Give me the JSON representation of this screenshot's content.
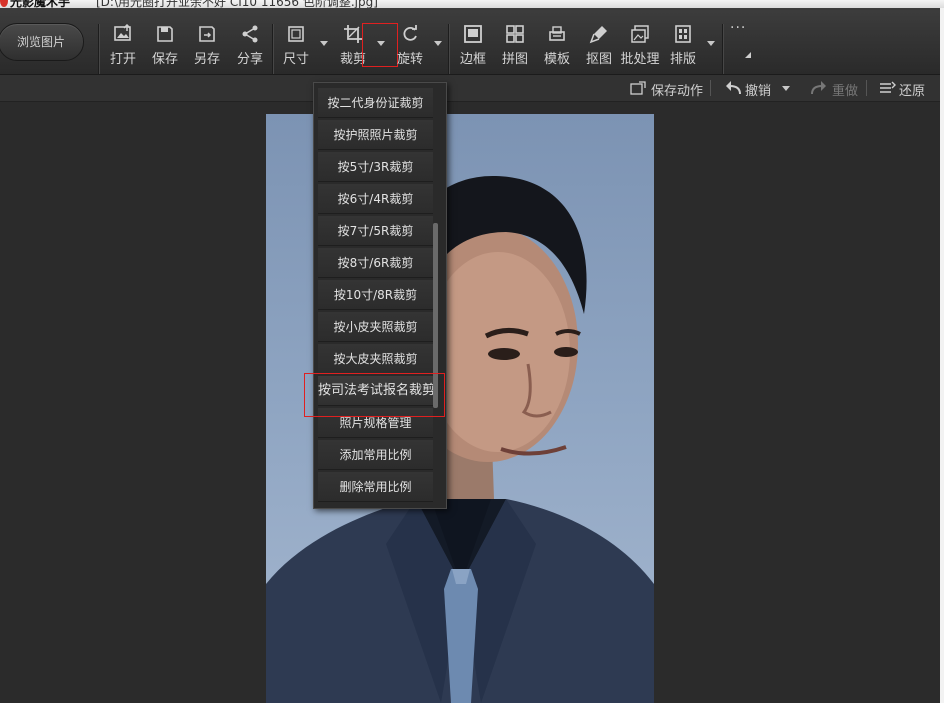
{
  "titlebar": {
    "app_name": "光影魔术手",
    "doc_title": "[D:\\用光圈打开业余不好 CI10 11656 色阶调整.jpg]"
  },
  "toolbar": {
    "browse_label": "浏览图片",
    "tools": [
      {
        "id": "open",
        "label": "打开",
        "icon": "image-open-icon"
      },
      {
        "id": "save",
        "label": "保存",
        "icon": "save-icon"
      },
      {
        "id": "saveas",
        "label": "另存",
        "icon": "save-as-icon"
      },
      {
        "id": "share",
        "label": "分享",
        "icon": "share-icon"
      },
      {
        "id": "size",
        "label": "尺寸",
        "icon": "resize-icon"
      },
      {
        "id": "crop",
        "label": "裁剪",
        "icon": "crop-icon"
      },
      {
        "id": "rotate",
        "label": "旋转",
        "icon": "rotate-icon"
      },
      {
        "id": "border",
        "label": "边框",
        "icon": "border-icon"
      },
      {
        "id": "collage",
        "label": "拼图",
        "icon": "collage-icon"
      },
      {
        "id": "template",
        "label": "模板",
        "icon": "template-icon"
      },
      {
        "id": "cutout",
        "label": "抠图",
        "icon": "cutout-icon"
      },
      {
        "id": "batch",
        "label": "批处理",
        "icon": "batch-icon"
      },
      {
        "id": "layout",
        "label": "排版",
        "icon": "layout-icon"
      }
    ],
    "more_label": "···"
  },
  "subbar": {
    "save_action": "保存动作",
    "undo": "撤销",
    "redo": "重做",
    "restore": "还原"
  },
  "crop_menu": {
    "items": [
      "按二代身份证裁剪",
      "按护照照片裁剪",
      "按5寸/3R裁剪",
      "按6寸/4R裁剪",
      "按7寸/5R裁剪",
      "按8寸/6R裁剪",
      "按10寸/8R裁剪",
      "按小皮夹照裁剪",
      "按大皮夹照裁剪",
      "按司法考试报名裁剪",
      "照片规格管理",
      "添加常用比例",
      "删除常用比例"
    ]
  },
  "colors": {
    "toolbar_bg": "#353535",
    "canvas_bg": "#2b2b2b",
    "highlight": "#e02020",
    "photo_bg": "#8fa5c2"
  }
}
